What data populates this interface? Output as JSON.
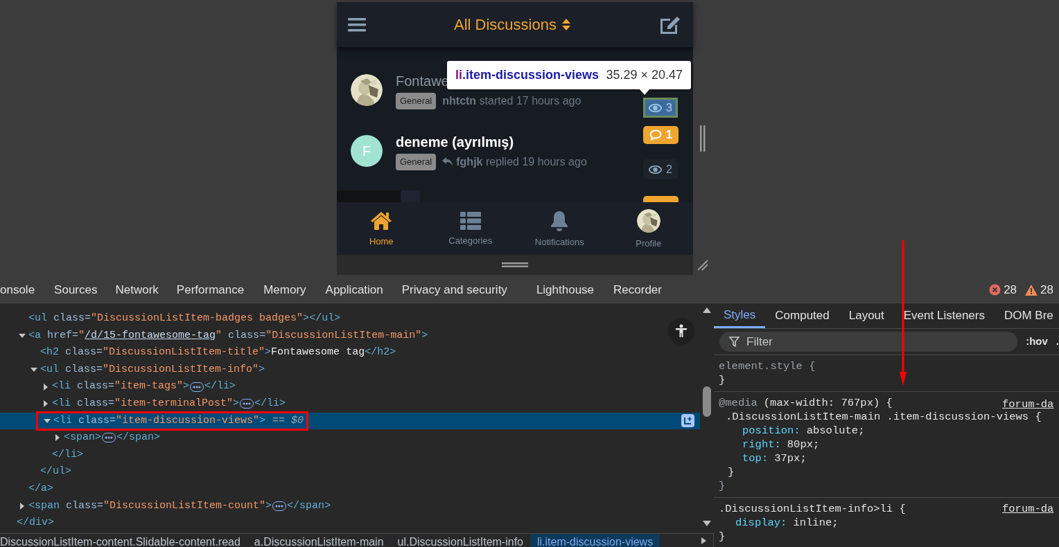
{
  "device": {
    "header": {
      "title": "All Discussions"
    },
    "discussions": [
      {
        "kind": "inspected",
        "title": "Fontawe",
        "read": true,
        "tag": "General",
        "author": "nhtctn",
        "activity": "started 17 hours ago",
        "replied": false,
        "views": "3"
      },
      {
        "kind": "normal",
        "avatar_letter": "F",
        "color": "#a0e3d1",
        "title": "deneme (ayrılmış)",
        "read": false,
        "tag": "General",
        "author": "fghjk",
        "activity": "replied 19 hours ago",
        "replied": true,
        "replies": "1",
        "views": "2"
      },
      {
        "kind": "partial"
      }
    ],
    "tooltip": {
      "tag": "li",
      "classes": ".item-discussion-views",
      "size": "35.29 × 20.47"
    },
    "nav": [
      {
        "kind": "home",
        "label": "Home",
        "selected": true
      },
      {
        "kind": "categories",
        "label": "Categories",
        "selected": false
      },
      {
        "kind": "notifications",
        "label": "Notifications",
        "selected": false
      },
      {
        "kind": "profile",
        "label": "Profile",
        "selected": false
      }
    ]
  },
  "devtools": {
    "tabs": [
      "onsole",
      "Sources",
      "Network",
      "Performance",
      "Memory",
      "Application",
      "Privacy and security",
      "Lighthouse",
      "Recorder"
    ],
    "errors": "28",
    "warnings": "28",
    "dom": {
      "close": "</div>",
      "children": [
        {
          "open": "<ul class=\"DiscussionListItem-badges badges\"></ul>"
        },
        {
          "open": "<a href=\"/d/15-fontawesome-tag\" class=\"DiscussionListItem-main\">",
          "expanded": true,
          "close": "</a>",
          "children": [
            {
              "open": "<h2 class=\"DiscussionListItem-title\">Fontawesome tag</h2>"
            },
            {
              "open": "<ul class=\"DiscussionListItem-info\">",
              "expanded": true,
              "close": "</ul>",
              "children": [
                {
                  "open": "<li class=\"item-tags\">",
                  "expanded": false,
                  "collapsed": true,
                  "close": "</li>"
                },
                {
                  "open": "<li class=\"item-terminalPost\">",
                  "expanded": false,
                  "collapsed": true,
                  "close": "</li>"
                },
                {
                  "open": "<li class=\"item-discussion-views\">",
                  "expanded": true,
                  "selected": true,
                  "suffix": "== $0",
                  "close": "</li>",
                  "children": [
                    {
                      "open": "<span>",
                      "expanded": false,
                      "collapsed": true,
                      "close": "</span>"
                    }
                  ]
                }
              ]
            }
          ]
        },
        {
          "open": "<span class=\"DiscussionListItem-count\">",
          "expanded": false,
          "collapsed": true,
          "close": "</span>"
        }
      ]
    },
    "breadcrumbs": [
      {
        "label": "DiscussionListItem-content.Slidable-content.read",
        "selected": false
      },
      {
        "label": "a.DiscussionListItem-main",
        "selected": false
      },
      {
        "label": "ul.DiscussionListItem-info",
        "selected": false
      },
      {
        "label": "li.item-discussion-views",
        "selected": true
      }
    ],
    "styles": {
      "tabs": [
        {
          "label": "Styles",
          "selected": true
        },
        {
          "label": "Computed",
          "selected": false
        },
        {
          "label": "Layout",
          "selected": false
        },
        {
          "label": "Event Listeners",
          "selected": false
        },
        {
          "label": "DOM Bre",
          "selected": false
        }
      ],
      "filter": {
        "placeholder": "Filter"
      },
      "hov": ":hov",
      "cls": ".",
      "rules": [
        {
          "selector": "element.style {",
          "close": "}"
        },
        {
          "media": "@media",
          "media_query": "(max-width: 767px) {",
          "source": "forum-da",
          "selector": ".DiscussionListItem-main .item-discussion-views {",
          "properties": [
            {
              "name": "position:",
              "value": "absolute;"
            },
            {
              "name": "right:",
              "value": "80px;"
            },
            {
              "name": "top:",
              "value": "37px;"
            }
          ],
          "close": "}",
          "media_close": "}"
        },
        {
          "source": "forum-da",
          "selector": ".DiscussionListItem-info>li {",
          "properties": [
            {
              "name": "display:",
              "value": "inline;"
            }
          ],
          "close": "}"
        }
      ]
    }
  }
}
